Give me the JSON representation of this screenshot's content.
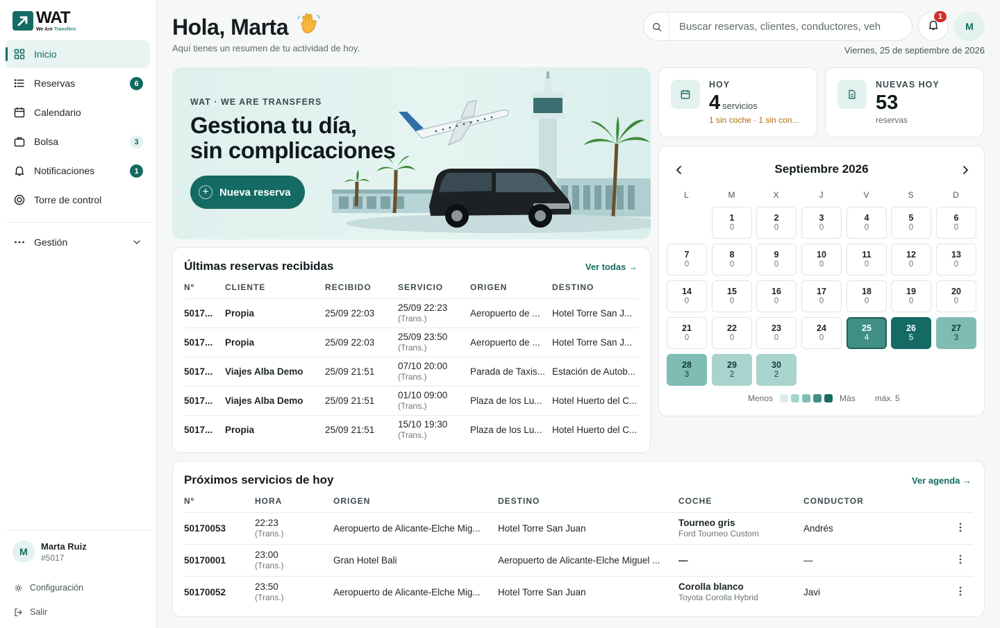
{
  "brand": {
    "name": "WAT",
    "tagline_a": "We Are ",
    "tagline_b": "Transfers"
  },
  "sidebar": {
    "items": [
      {
        "label": "Inicio",
        "icon": "grid-icon"
      },
      {
        "label": "Reservas",
        "icon": "list-icon",
        "badge": "6"
      },
      {
        "label": "Calendario",
        "icon": "calendar-icon"
      },
      {
        "label": "Bolsa",
        "icon": "bag-icon",
        "badge": "3"
      },
      {
        "label": "Notificaciones",
        "icon": "bell-icon",
        "badge": "1"
      },
      {
        "label": "Torre de control",
        "icon": "target-icon"
      }
    ],
    "management": "Gestión",
    "user": {
      "initial": "M",
      "name": "Marta Ruiz",
      "id": "#5017"
    },
    "settings": "Configuración",
    "logout": "Salir"
  },
  "header": {
    "greeting": "Hola, Marta",
    "subtitle": "Aquí tienes un resumen de tu actividad de hoy.",
    "search_placeholder": "Buscar reservas, clientes, conductores, veh",
    "notifications": "1",
    "avatar": "M",
    "date": "Viernes, 25 de septiembre de 2026"
  },
  "hero": {
    "kicker": "WAT · WE ARE TRANSFERS",
    "title_line1": "Gestiona tu día,",
    "title_line2": "sin complicaciones",
    "button": "Nueva reserva"
  },
  "stats": {
    "today": {
      "label": "HOY",
      "value": "4",
      "unit": "servicios",
      "note": "1 sin coche · 1 sin con..."
    },
    "new_today": {
      "label": "NUEVAS HOY",
      "value": "53",
      "unit": "reservas"
    }
  },
  "calendar": {
    "title": "Septiembre 2026",
    "weekdays": [
      "L",
      "M",
      "X",
      "J",
      "V",
      "S",
      "D"
    ],
    "first_weekday_index": 1,
    "days": [
      {
        "d": "1",
        "c": "0"
      },
      {
        "d": "2",
        "c": "0"
      },
      {
        "d": "3",
        "c": "0"
      },
      {
        "d": "4",
        "c": "0"
      },
      {
        "d": "5",
        "c": "0"
      },
      {
        "d": "6",
        "c": "0"
      },
      {
        "d": "7",
        "c": "0"
      },
      {
        "d": "8",
        "c": "0"
      },
      {
        "d": "9",
        "c": "0"
      },
      {
        "d": "10",
        "c": "0"
      },
      {
        "d": "11",
        "c": "0"
      },
      {
        "d": "12",
        "c": "0"
      },
      {
        "d": "13",
        "c": "0"
      },
      {
        "d": "14",
        "c": "0"
      },
      {
        "d": "15",
        "c": "0"
      },
      {
        "d": "16",
        "c": "0"
      },
      {
        "d": "17",
        "c": "0"
      },
      {
        "d": "18",
        "c": "0"
      },
      {
        "d": "19",
        "c": "0"
      },
      {
        "d": "20",
        "c": "0"
      },
      {
        "d": "21",
        "c": "0"
      },
      {
        "d": "22",
        "c": "0"
      },
      {
        "d": "23",
        "c": "0"
      },
      {
        "d": "24",
        "c": "0"
      },
      {
        "d": "25",
        "c": "4",
        "today": true
      },
      {
        "d": "26",
        "c": "5"
      },
      {
        "d": "27",
        "c": "3"
      },
      {
        "d": "28",
        "c": "3"
      },
      {
        "d": "29",
        "c": "2"
      },
      {
        "d": "30",
        "c": "2"
      }
    ],
    "legend_less": "Menos",
    "legend_more": "Más",
    "legend_max": "máx. 5",
    "scale_colors": [
      "#dceeeb",
      "#a9d3cd",
      "#7fbdb4",
      "#3f8f86",
      "#146b63"
    ]
  },
  "recent": {
    "title": "Últimas reservas recibidas",
    "link": "Ver todas →",
    "columns": [
      "Nº",
      "CLIENTE",
      "RECIBIDO",
      "SERVICIO",
      "ORIGEN",
      "DESTINO"
    ],
    "rows": [
      {
        "num": "5017...",
        "client": "Propia",
        "received": "25/09 22:03",
        "service": "25/09 22:23",
        "service_sub": "(Trans.)",
        "origin": "Aeropuerto de ...",
        "dest": "Hotel Torre San J..."
      },
      {
        "num": "5017...",
        "client": "Propia",
        "received": "25/09 22:03",
        "service": "25/09 23:50",
        "service_sub": "(Trans.)",
        "origin": "Aeropuerto de ...",
        "dest": "Hotel Torre San J..."
      },
      {
        "num": "5017...",
        "client": "Viajes Alba Demo",
        "received": "25/09 21:51",
        "service": "07/10 20:00",
        "service_sub": "(Trans.)",
        "origin": "Parada de Taxis...",
        "dest": "Estación de Autob..."
      },
      {
        "num": "5017...",
        "client": "Viajes Alba Demo",
        "received": "25/09 21:51",
        "service": "01/10 09:00",
        "service_sub": "(Trans.)",
        "origin": "Plaza de los Lu...",
        "dest": "Hotel Huerto del C..."
      },
      {
        "num": "5017...",
        "client": "Propia",
        "received": "25/09 21:51",
        "service": "15/10 19:30",
        "service_sub": "(Trans.)",
        "origin": "Plaza de los Lu...",
        "dest": "Hotel Huerto del C..."
      }
    ]
  },
  "upcoming": {
    "title": "Próximos servicios de hoy",
    "link": "Ver agenda →",
    "columns": [
      "Nº",
      "HORA",
      "ORIGEN",
      "DESTINO",
      "COCHE",
      "CONDUCTOR"
    ],
    "rows": [
      {
        "num": "50170053",
        "time": "22:23",
        "time_sub": "(Trans.)",
        "origin": "Aeropuerto de Alicante-Elche Mig...",
        "dest": "Hotel Torre San Juan",
        "car": "Tourneo gris",
        "car_sub": "Ford Tourneo Custom",
        "driver": "Andrés"
      },
      {
        "num": "50170001",
        "time": "23:00",
        "time_sub": "(Trans.)",
        "origin": "Gran Hotel Bali",
        "dest": "Aeropuerto de Alicante-Elche Miguel ...",
        "car": "—",
        "car_sub": "",
        "driver": "—"
      },
      {
        "num": "50170052",
        "time": "23:50",
        "time_sub": "(Trans.)",
        "origin": "Aeropuerto de Alicante-Elche Mig...",
        "dest": "Hotel Torre San Juan",
        "car": "Corolla blanco",
        "car_sub": "Toyota Corolla Hybrid",
        "driver": "Javi"
      }
    ]
  }
}
